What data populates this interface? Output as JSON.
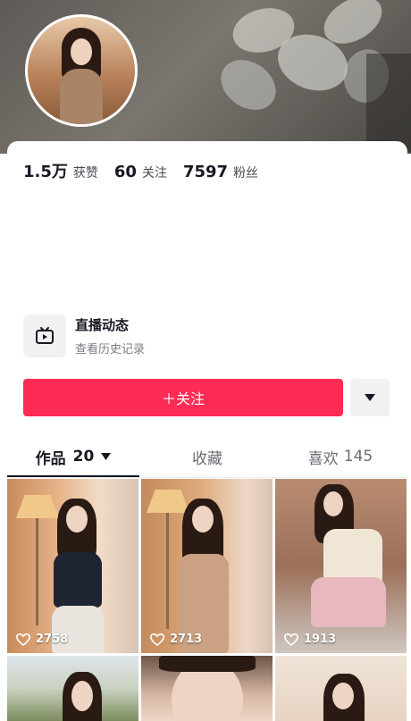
{
  "stats": {
    "likes_value": "1.5万",
    "likes_label": "获赞",
    "following_value": "60",
    "following_label": "关注",
    "followers_value": "7597",
    "followers_label": "粉丝"
  },
  "live": {
    "title": "直播动态",
    "subtitle": "查看历史记录",
    "icon": "tv-icon"
  },
  "actions": {
    "follow_label": "＋关注",
    "more_icon": "caret-down-icon"
  },
  "tabs": {
    "works_label": "作品",
    "works_count": "20",
    "favorites_label": "收藏",
    "likes_label": "喜欢",
    "likes_count": "145"
  },
  "videos": [
    {
      "likes": "2758"
    },
    {
      "likes": "2713"
    },
    {
      "likes": "1913"
    }
  ],
  "colors": {
    "accent": "#fe2c55",
    "text_primary": "#161823",
    "text_secondary": "#7a7b82"
  }
}
